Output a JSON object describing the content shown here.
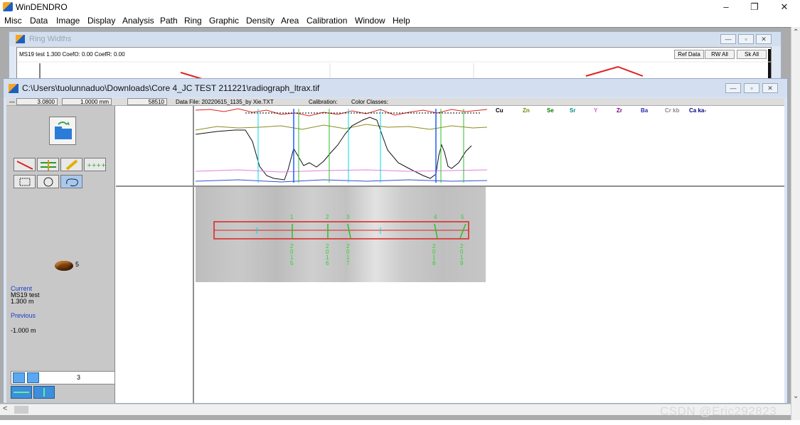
{
  "app": {
    "title": "WinDENDRO"
  },
  "menu": [
    "Misc",
    "Data",
    "Image",
    "Display",
    "Analysis",
    "Path",
    "Ring",
    "Graphic",
    "Density",
    "Area",
    "Calibration",
    "Window",
    "Help"
  ],
  "ring_widths": {
    "title": "Ring Widths",
    "info": "MS19 test 1.300  CoefO: 0.00  CoefR: 0.00",
    "buttons": [
      "Ref Data",
      "RW All",
      "Sk All"
    ]
  },
  "image_window": {
    "title": "C:\\Users\\tuolunnaduo\\Downloads\\Core 4_JC TEST 211221\\radiograph_ltrax.tif",
    "field1": "3.0800",
    "field2": "1.0000 mm",
    "field3": "58510",
    "data_file": "Data File: 20220615_1135_by Xie.TXT",
    "calibration": "Calibration:",
    "color_classes": "Color Classes:"
  },
  "elements": [
    {
      "label": "Cu",
      "color": "#000000"
    },
    {
      "label": "Zn",
      "color": "#6a8a00"
    },
    {
      "label": "Se",
      "color": "#007a00"
    },
    {
      "label": "Sr",
      "color": "#008a8a"
    },
    {
      "label": "Y",
      "color": "#d85ad8"
    },
    {
      "label": "Zr",
      "color": "#7a007a"
    },
    {
      "label": "Ba",
      "color": "#2a2ab0"
    },
    {
      "label": "Cr kb",
      "color": "#888888"
    },
    {
      "label": "Ca ka-",
      "color": "#000080"
    }
  ],
  "side": {
    "sample_count": "5",
    "current_label": "Current",
    "current_name": "MS19 test",
    "current_value": "1.300 m",
    "previous_label": "Previous",
    "previous_value": "-1.000 m",
    "zoom_value": "3"
  },
  "rings": [
    {
      "n": "1",
      "year": "2015"
    },
    {
      "n": "2",
      "year": "2016"
    },
    {
      "n": "3",
      "year": "2017"
    },
    {
      "n": "4",
      "year": "2018"
    },
    {
      "n": "5",
      "year": "2019"
    }
  ],
  "watermark": "CSDN @Eric292823",
  "colors": {
    "mdi_bg": "#ababab",
    "panel": "#c8c8c8",
    "profile_red": "#e02020"
  }
}
